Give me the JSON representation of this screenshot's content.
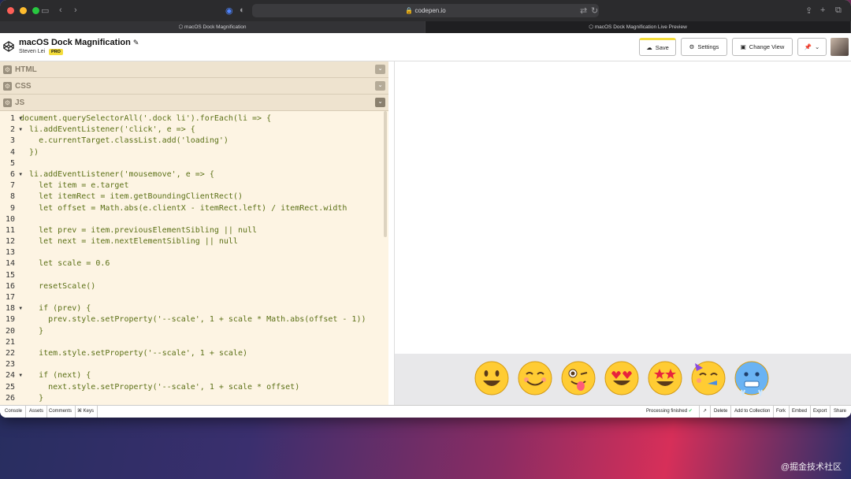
{
  "browser": {
    "url": "codepen.io",
    "tabs": [
      "macOS Dock Magnification",
      "macOS Dock Magnification Live Preview"
    ]
  },
  "pen": {
    "title": "macOS Dock Magnification",
    "author": "Steven Lei",
    "badge": "PRO"
  },
  "header_buttons": {
    "save": "Save",
    "settings": "Settings",
    "change_view": "Change View"
  },
  "panels": {
    "html": "HTML",
    "css": "CSS",
    "js": "JS"
  },
  "code_lines": [
    "document.querySelectorAll('.dock li').forEach(li => {",
    "  li.addEventListener('click', e => {",
    "    e.currentTarget.classList.add('loading')",
    "  })",
    "",
    "  li.addEventListener('mousemove', e => {",
    "    let item = e.target",
    "    let itemRect = item.getBoundingClientRect()",
    "    let offset = Math.abs(e.clientX - itemRect.left) / itemRect.width",
    "",
    "    let prev = item.previousElementSibling || null",
    "    let next = item.nextElementSibling || null",
    "",
    "    let scale = 0.6",
    "",
    "    resetScale()",
    "",
    "    if (prev) {",
    "      prev.style.setProperty('--scale', 1 + scale * Math.abs(offset - 1))",
    "    }",
    "",
    "    item.style.setProperty('--scale', 1 + scale)",
    "",
    "    if (next) {",
    "      next.style.setProperty('--scale', 1 + scale * offset)",
    "    }"
  ],
  "folded_lines": [
    1,
    2,
    6,
    18,
    24
  ],
  "footer": {
    "left": [
      "Console",
      "Assets",
      "Comments",
      "⌘ Keys"
    ],
    "status": "Processing finished",
    "right": [
      "Delete",
      "Add to Collection",
      "Fork",
      "Embed",
      "Export",
      "Share"
    ]
  },
  "dock_emojis": [
    "grinning-face",
    "smiling-face",
    "winking-face-tongue",
    "heart-eyes-face",
    "star-struck-face",
    "partying-face",
    "cold-face"
  ],
  "watermark": "@掘金技术社区",
  "colors": {
    "editor_bg": "#fdf4e3",
    "code_text": "#5b7016",
    "accent_save": "#f3dc3b"
  }
}
